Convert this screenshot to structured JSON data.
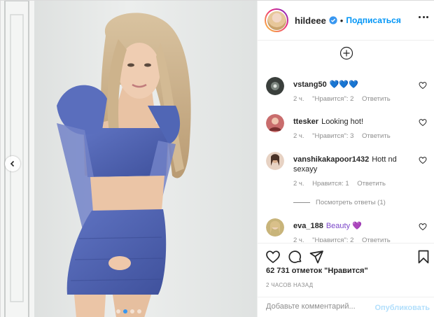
{
  "post": {
    "username": "hildeee",
    "separator": "•",
    "follow_label": "Подписаться",
    "verified_icon": "verified-badge-icon",
    "more_icon": "more-options-icon"
  },
  "comments": [
    {
      "username": "vstang50",
      "text": "💙💙💙",
      "time": "2 ч.",
      "likes": "\"Нравится\": 2",
      "reply": "Ответить",
      "avatar_color": "#3a3f3c"
    },
    {
      "username": "ttesker",
      "text": "Looking hot!",
      "time": "2 ч.",
      "likes": "\"Нравится\": 3",
      "reply": "Ответить",
      "avatar_color": "#c26b6b"
    },
    {
      "username": "vanshikakapoor1432",
      "text": "Hott nd sexayy",
      "time": "2 ч.",
      "likes": "Нравится: 1",
      "reply": "Ответить",
      "avatar_color": "#d8b49a"
    },
    {
      "username": "eva_188",
      "text": "Beauty 💜",
      "time": "2 ч.",
      "likes": "\"Нравится\": 2",
      "reply": "Ответить",
      "avatar_color": "#b9a56e"
    }
  ],
  "replies_label": "Посмотреть ответы (1)",
  "likes_count": "62 731 отметок \"Нравится\"",
  "posted_ago": "2 ЧАСОВ НАЗАД",
  "add_comment": {
    "placeholder": "Добавьте комментарий...",
    "publish_label": "Опубликовать"
  },
  "colors": {
    "accent": "#0095f6",
    "publish_disabled": "#b2dffc",
    "active_dot": "#3897f0"
  },
  "carousel": {
    "dots": 4,
    "active_dot": 1
  }
}
